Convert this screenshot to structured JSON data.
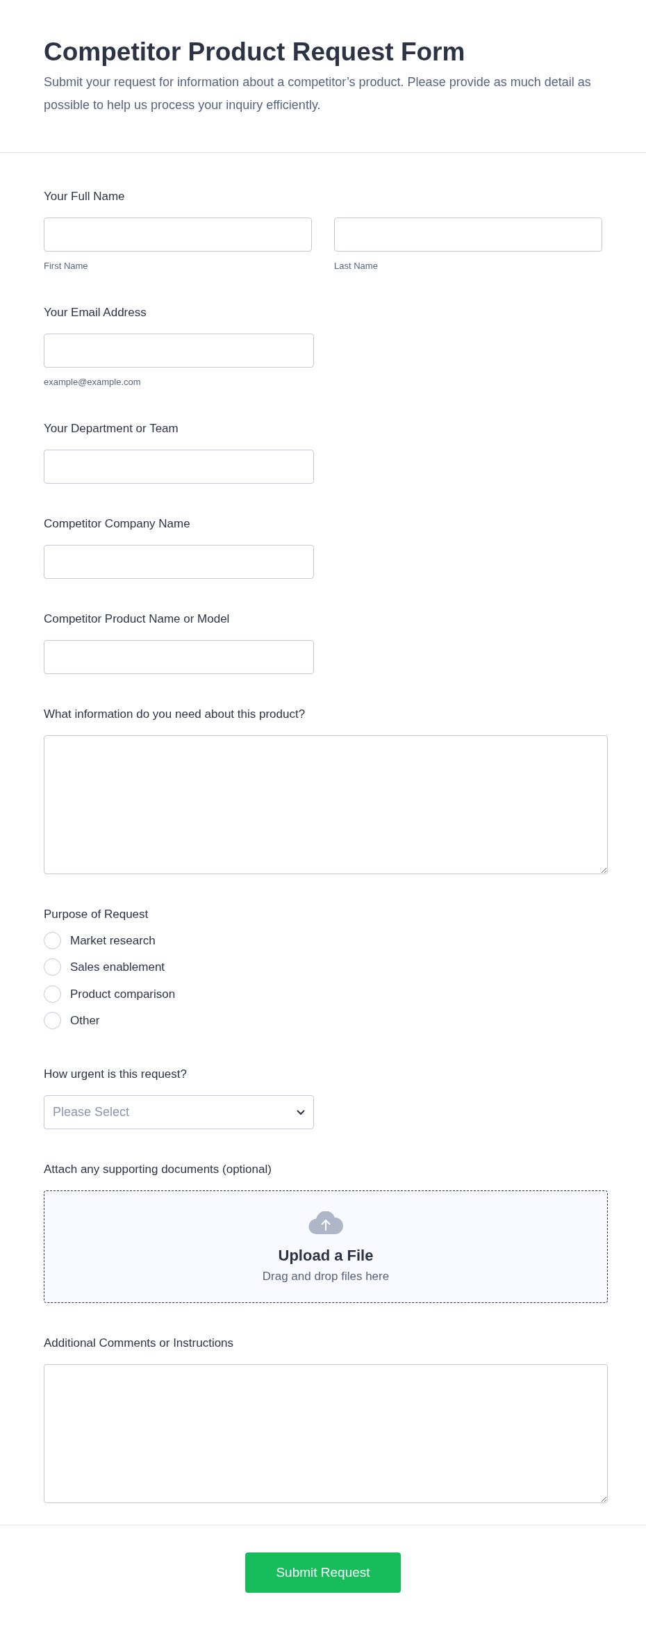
{
  "header": {
    "title": "Competitor Product Request Form",
    "description": "Submit your request for information about a competitor’s product. Please provide as much detail as possible to help us process your inquiry efficiently."
  },
  "fields": [
    {
      "kind": "name",
      "label": "Your Full Name",
      "sublabels": [
        "First Name",
        "Last Name"
      ]
    },
    {
      "kind": "text",
      "label": "Your Email Address",
      "sublabel": "example@example.com"
    },
    {
      "kind": "text",
      "label": "Your Department or Team"
    },
    {
      "kind": "text",
      "label": "Competitor Company Name"
    },
    {
      "kind": "text",
      "label": "Competitor Product Name or Model"
    },
    {
      "kind": "textarea",
      "label": "What information do you need about this product?"
    },
    {
      "kind": "radio",
      "label": "Purpose of Request",
      "options": [
        {
          "label": "Market research",
          "selected": false
        },
        {
          "label": "Sales enablement",
          "selected": false
        },
        {
          "label": "Product comparison",
          "selected": false
        },
        {
          "label": "Other",
          "selected": false
        }
      ]
    },
    {
      "kind": "select",
      "label": "How urgent is this request?",
      "placeholder": "Please Select"
    },
    {
      "kind": "upload",
      "label": "Attach any supporting documents (optional)",
      "title": "Upload a File",
      "hint": "Drag and drop files here"
    },
    {
      "kind": "textarea",
      "label": "Additional Comments or Instructions"
    }
  ],
  "submit": {
    "label": "Submit Request"
  }
}
